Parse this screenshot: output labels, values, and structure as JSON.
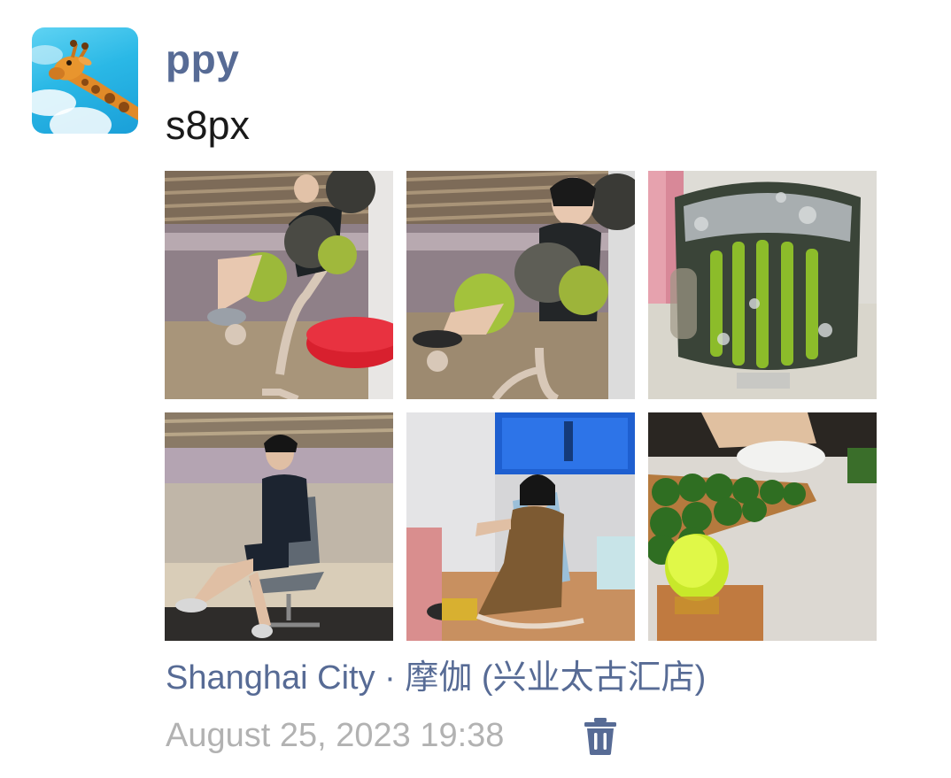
{
  "post": {
    "username": "ppy",
    "text": "s8px",
    "location": "Shanghai City · 摩伽 (兴业太古汇店)",
    "timestamp": "August 25, 2023 19:38"
  },
  "avatar": {
    "icon": "giraffe-avatar",
    "background_color": "#2ab8e6"
  },
  "photos": [
    {
      "icon": "photo-massage-chair-man"
    },
    {
      "icon": "photo-massage-chair-woman"
    },
    {
      "icon": "photo-reflective-vase"
    },
    {
      "icon": "photo-man-in-office-chair"
    },
    {
      "icon": "photo-woman-in-office-chair"
    },
    {
      "icon": "photo-green-fruit-tray"
    }
  ],
  "colors": {
    "link": "#576b95",
    "text": "#1a1a1a",
    "muted": "#b2b2b2"
  },
  "actions": {
    "delete_icon": "trash-icon"
  }
}
